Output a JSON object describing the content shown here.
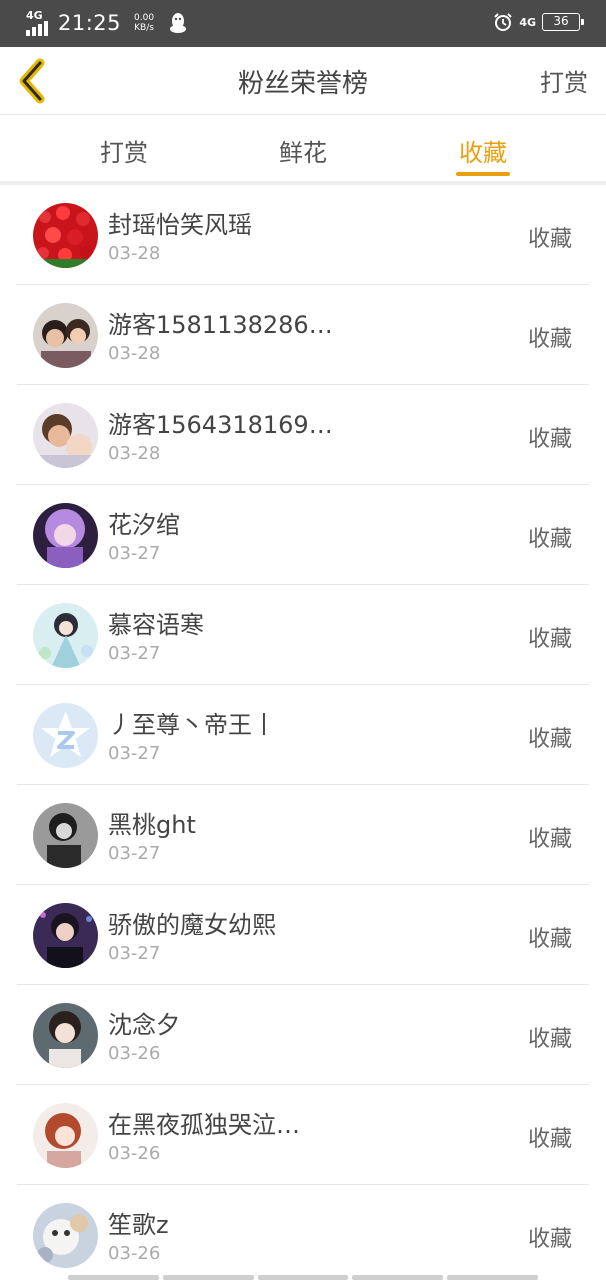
{
  "statusbar": {
    "network": "4G",
    "time": "21:25",
    "speed_value": "0.00",
    "speed_unit": "KB/s",
    "right_network": "4G",
    "battery": "36",
    "icons": [
      "signal-icon",
      "qq-penguin-icon",
      "alarm-icon",
      "battery-icon"
    ]
  },
  "navbar": {
    "title": "粉丝荣誉榜",
    "action": "打赏",
    "back_icon": "chevron-left-icon"
  },
  "tabs": [
    {
      "label": "打赏",
      "active": false
    },
    {
      "label": "鲜花",
      "active": false
    },
    {
      "label": "收藏",
      "active": true
    }
  ],
  "accent_color": "#e8a010",
  "rows": [
    {
      "name": "封瑶怡笑风瑶",
      "date": "03-28",
      "action": "收藏"
    },
    {
      "name": "游客1581138286…",
      "date": "03-28",
      "action": "收藏"
    },
    {
      "name": "游客1564318169…",
      "date": "03-28",
      "action": "收藏"
    },
    {
      "name": "花汐绾",
      "date": "03-27",
      "action": "收藏"
    },
    {
      "name": "慕容语寒",
      "date": "03-27",
      "action": "收藏"
    },
    {
      "name": "丿至尊丶帝王丨",
      "date": "03-27",
      "action": "收藏"
    },
    {
      "name": "黑桃ght",
      "date": "03-27",
      "action": "收藏"
    },
    {
      "name": "骄傲的魔女幼熙",
      "date": "03-27",
      "action": "收藏"
    },
    {
      "name": "沈念夕",
      "date": "03-26",
      "action": "收藏"
    },
    {
      "name": "在黑夜孤独哭泣…",
      "date": "03-26",
      "action": "收藏"
    },
    {
      "name": "笙歌z",
      "date": "03-26",
      "action": "收藏"
    }
  ]
}
